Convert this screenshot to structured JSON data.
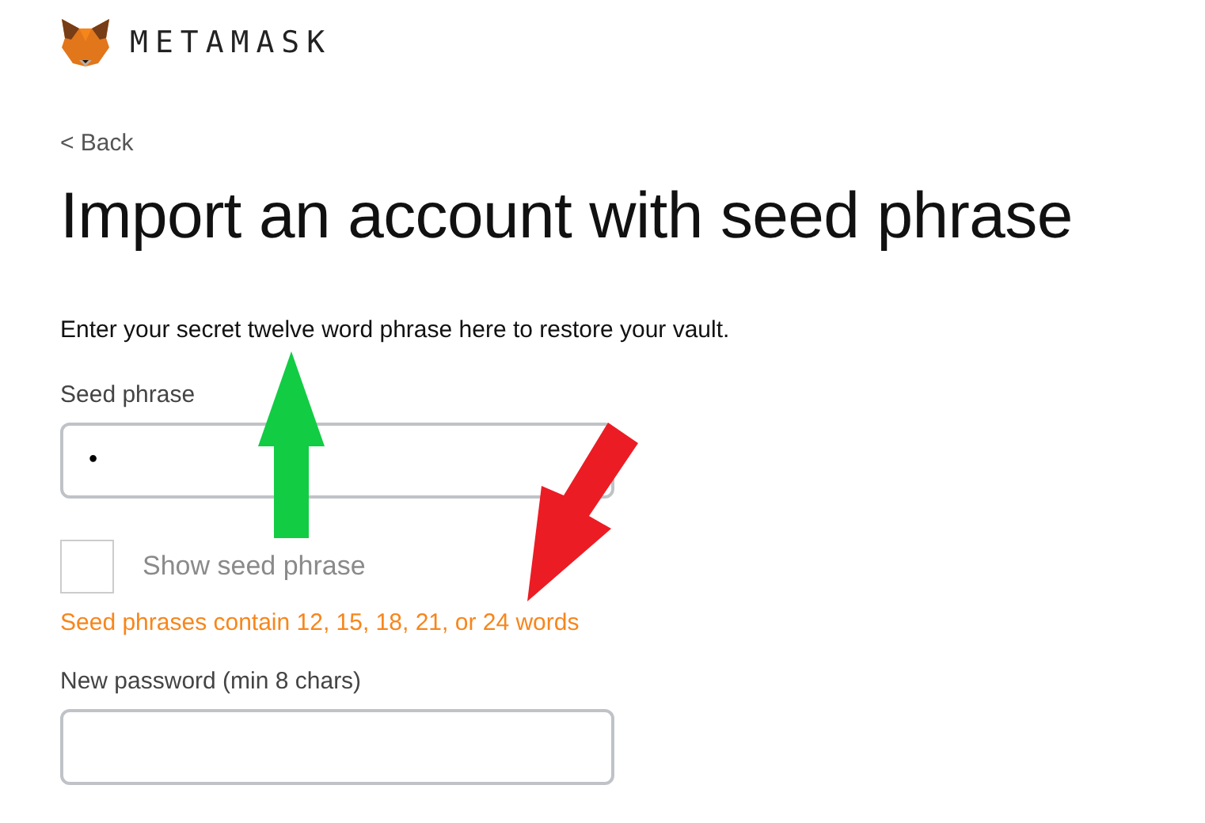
{
  "brand": {
    "name": "METAMASK"
  },
  "back_link": "< Back",
  "title": "Import an account with seed phrase",
  "instructions": "Enter your secret twelve word phrase here to restore your vault.",
  "seed_phrase": {
    "label": "Seed phrase",
    "value": "•"
  },
  "show_seed_phrase": {
    "label": "Show seed phrase",
    "checked": false
  },
  "error": "Seed phrases contain 12, 15, 18, 21, or 24 words",
  "new_password": {
    "label": "New password (min 8 chars)"
  }
}
